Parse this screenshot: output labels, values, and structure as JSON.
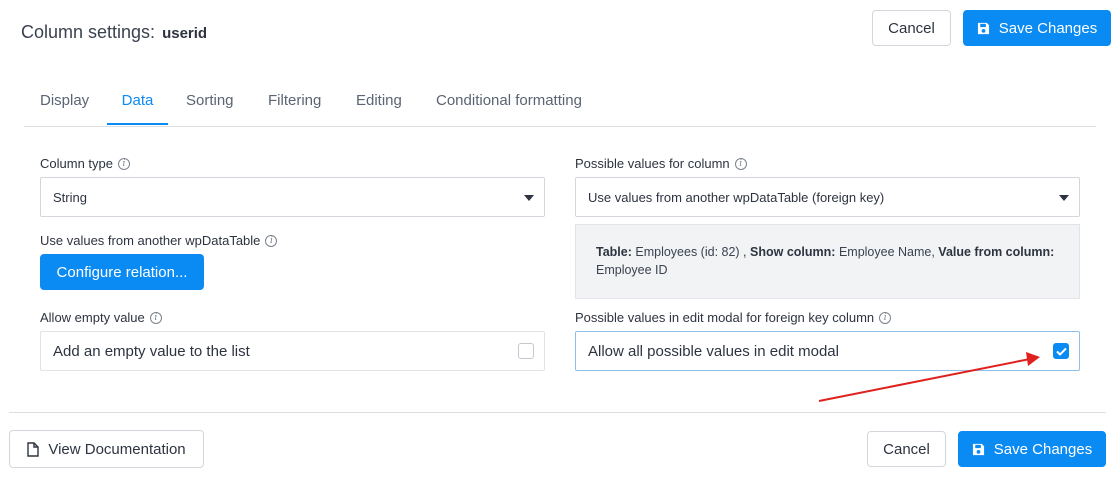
{
  "header": {
    "title_prefix": "Column settings:",
    "column_name": "userid",
    "cancel_label": "Cancel",
    "save_label": "Save Changes"
  },
  "tabs": [
    {
      "label": "Display",
      "active": false
    },
    {
      "label": "Data",
      "active": true
    },
    {
      "label": "Sorting",
      "active": false
    },
    {
      "label": "Filtering",
      "active": false
    },
    {
      "label": "Editing",
      "active": false
    },
    {
      "label": "Conditional formatting",
      "active": false
    }
  ],
  "left": {
    "column_type_label": "Column type",
    "column_type_value": "String",
    "foreign_label": "Use values from another wpDataTable",
    "configure_button": "Configure relation...",
    "allow_empty_label": "Allow empty value",
    "allow_empty_option": "Add an empty value to the list",
    "allow_empty_checked": false
  },
  "right": {
    "possible_values_label": "Possible values for column",
    "possible_values_value": "Use values from another wpDataTable (foreign key)",
    "info": {
      "table_key": "Table:",
      "table_value": "Employees (id: 82) ,",
      "show_key": "Show column:",
      "show_value": "Employee Name,",
      "value_key": "Value from column:",
      "value_value": "Employee ID"
    },
    "edit_modal_label": "Possible values in edit modal for foreign key column",
    "edit_modal_option": "Allow all possible values in edit modal",
    "edit_modal_checked": true
  },
  "footer": {
    "docs_label": "View Documentation",
    "cancel_label": "Cancel",
    "save_label": "Save Changes"
  },
  "colors": {
    "accent": "#0a8af3",
    "annotation_arrow": "#e0201c"
  },
  "icons": {
    "info": "info-icon",
    "save": "floppy-disk-icon",
    "document": "document-icon",
    "checkmark": "checkmark-icon",
    "caret": "caret-down-icon"
  }
}
